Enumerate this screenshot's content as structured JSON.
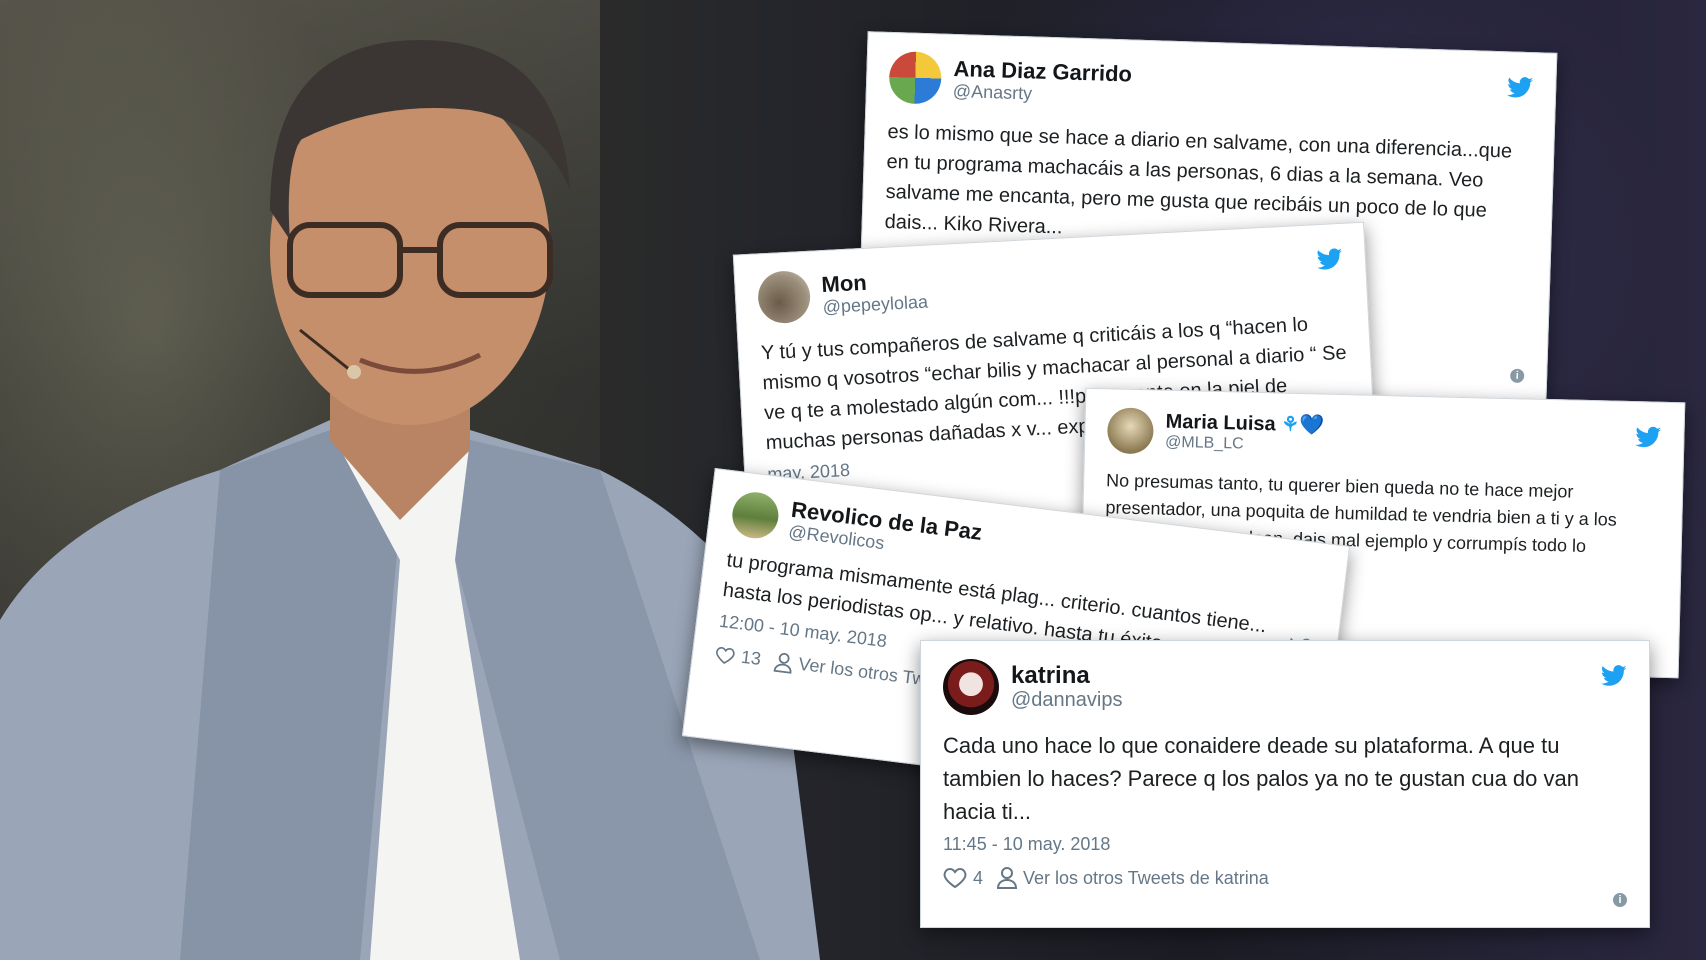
{
  "tweets": [
    {
      "name": "Ana Diaz Garrido",
      "handle": "@Anasrty",
      "text": "es lo mismo que se hace a diario en salvame, con una diferencia...que en tu programa machacáis a las personas, 6 dias a la semana. Veo salvame me encanta, pero me gusta que recibáis un poco de lo que dais... Kiko Rivera..."
    },
    {
      "name": "Mon",
      "handle": "@pepeylolaa",
      "text": "Y tú y tus compañeros de salvame  q criticáis a los q “hacen lo mismo q vosotros  “echar bilis y machacar al personal a diario “ Se ve q te a molestado algún com... !!!pues ponte en la piel de muchas personas dañadas x v... expresión siempre 👍👏👏👏",
      "time": "may. 2018"
    },
    {
      "name": "Maria Luisa",
      "name_emoji": "⚘💙",
      "handle": "@MLB_LC",
      "text": "No presumas tanto, tu querer bien queda no te hace mejor presentador, una poquita de humildad te vendria bien a ti y a los colegas que te rodean, dais mal ejemplo y corrumpís todo lo"
    },
    {
      "name": "Revolico de la Paz",
      "handle": "@Revolicos",
      "text": "tu programa mismamente está plag... criterio. cuantos tiene... hasta los periodistas op... y relativo. hasta tu éxito...",
      "time": "12:00 - 10 may. 2018",
      "likes": "13",
      "others": "Ver los otros Twe"
    },
    {
      "name": "katrina",
      "handle": "@dannavips",
      "text": "Cada uno hace lo que conaidere deade su plataforma. A que tu tambien lo haces? Parece q los palos ya no te gustan cua do van hacia ti...",
      "time": "11:45 - 10 may. 2018",
      "likes": "4",
      "others": "Ver los otros Tweets de katrina"
    }
  ],
  "colors": {
    "twitter_blue": "#1da1f2",
    "secondary_text": "#657786",
    "card_bg": "#ffffff"
  },
  "icons": [
    "twitter-bird-icon",
    "heart-icon",
    "user-icon",
    "info-icon"
  ]
}
